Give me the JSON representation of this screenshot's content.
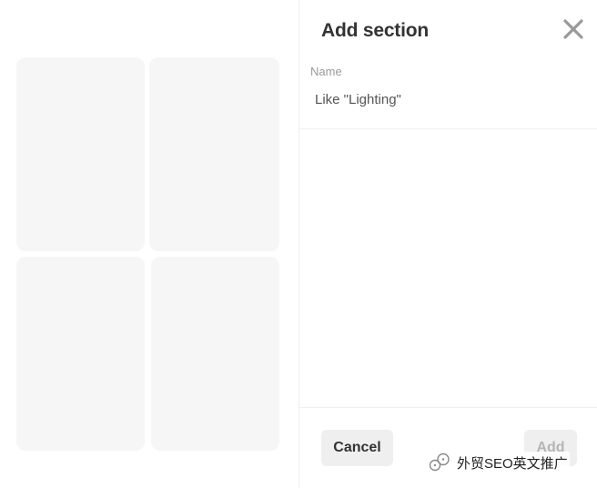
{
  "dialog": {
    "title": "Add section",
    "close_icon": "close-icon"
  },
  "form": {
    "name_label": "Name",
    "name_placeholder": "Like \"Lighting\"",
    "name_value": ""
  },
  "buttons": {
    "cancel_label": "Cancel",
    "add_label": "Add"
  },
  "watermark": {
    "text": "外贸SEO英文推广",
    "icon": "wechat-logo-icon"
  },
  "colors": {
    "placeholder_card": "#f6f6f6",
    "button_bg": "#efefef",
    "title_text": "#333333",
    "disabled_text": "#b5b5b5"
  }
}
